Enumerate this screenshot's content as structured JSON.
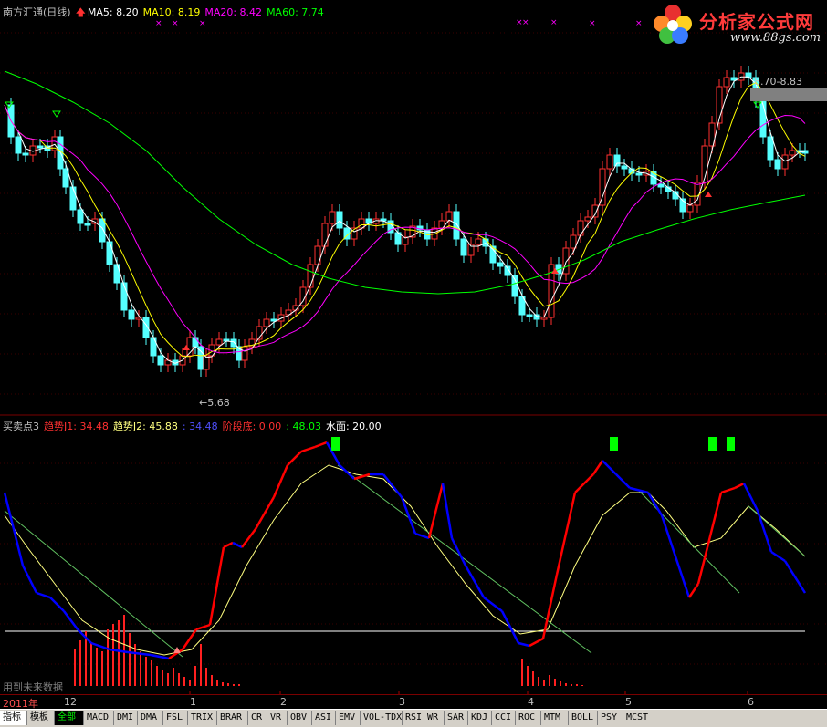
{
  "main_header": {
    "title": "南方汇通(日线)",
    "ma5": "MA5: 8.20",
    "ma10": "MA10: 8.19",
    "ma20": "MA20: 8.42",
    "ma60": "MA60: 7.74"
  },
  "indicator_header": {
    "name": "买卖点3",
    "j1": "趋势J1: 34.48",
    "j2": "趋势J2: 45.88",
    "dash": ": 34.48",
    "stage_bottom": "阶段底: 0.00",
    "stage_top": ": 48.03",
    "water": "水面: 20.00"
  },
  "annotations": {
    "range_label": "8.70-8.83",
    "low_label": "←5.68",
    "future_note": "用到未来数据"
  },
  "logo": {
    "name": "分析家公式网",
    "url": "www.88gs.com"
  },
  "date_axis": {
    "year": "2011年",
    "labels": [
      "12",
      "1",
      "2",
      "3",
      "4",
      "5",
      "6"
    ]
  },
  "tabs": [
    "指标",
    "模板",
    "全部",
    "MACD",
    "DMI",
    "DMA",
    "FSL",
    "TRIX",
    "BRAR",
    "CR",
    "VR",
    "OBV",
    "ASI",
    "EMV",
    "VOL-TDX",
    "RSI",
    "WR",
    "SAR",
    "KDJ",
    "CCI",
    "ROC",
    "MTM",
    "BOLL",
    "PSY",
    "MCST"
  ],
  "colors": {
    "up": "#ff3030",
    "down": "#54ffff",
    "ma5": "#ffffff",
    "ma10": "#ffff00",
    "ma20": "#ff00ff",
    "ma60": "#00ff00",
    "j1_up": "#ff0000",
    "j1_down": "#0000ff",
    "j2": "#ffff80",
    "signal": "#00ff00"
  }
}
